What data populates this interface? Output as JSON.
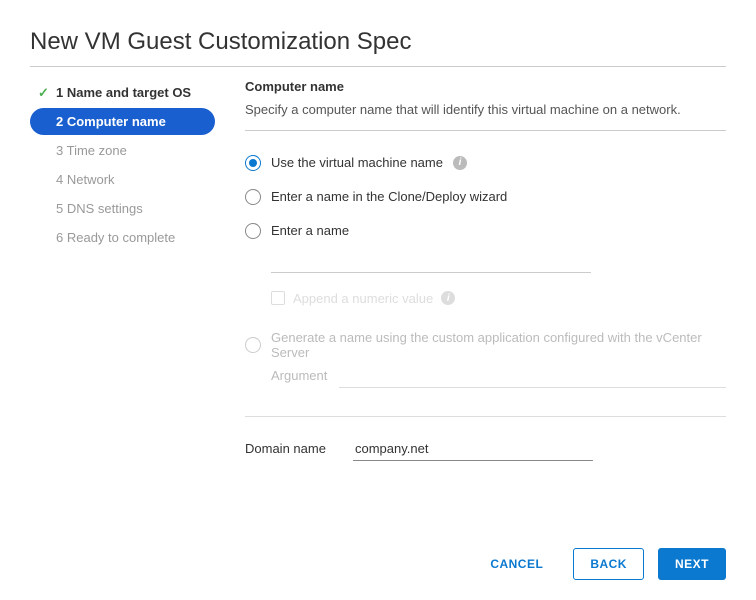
{
  "dialog": {
    "title": "New VM Guest Customization Spec"
  },
  "steps": [
    {
      "label": "1 Name and target OS"
    },
    {
      "label": "2 Computer name"
    },
    {
      "label": "3 Time zone"
    },
    {
      "label": "4 Network"
    },
    {
      "label": "5 DNS settings"
    },
    {
      "label": "6 Ready to complete"
    }
  ],
  "section": {
    "title": "Computer name",
    "description": "Specify a computer name that will identify this virtual machine on a network."
  },
  "options": {
    "use_vm_name": "Use the virtual machine name",
    "enter_wizard": "Enter a name in the Clone/Deploy wizard",
    "enter_name": "Enter a name",
    "append_numeric": "Append a numeric value",
    "generate": "Generate a name using the custom application configured with the vCenter Server",
    "argument_label": "Argument"
  },
  "domain": {
    "label": "Domain name",
    "value": "company.net"
  },
  "buttons": {
    "cancel": "CANCEL",
    "back": "BACK",
    "next": "NEXT"
  }
}
